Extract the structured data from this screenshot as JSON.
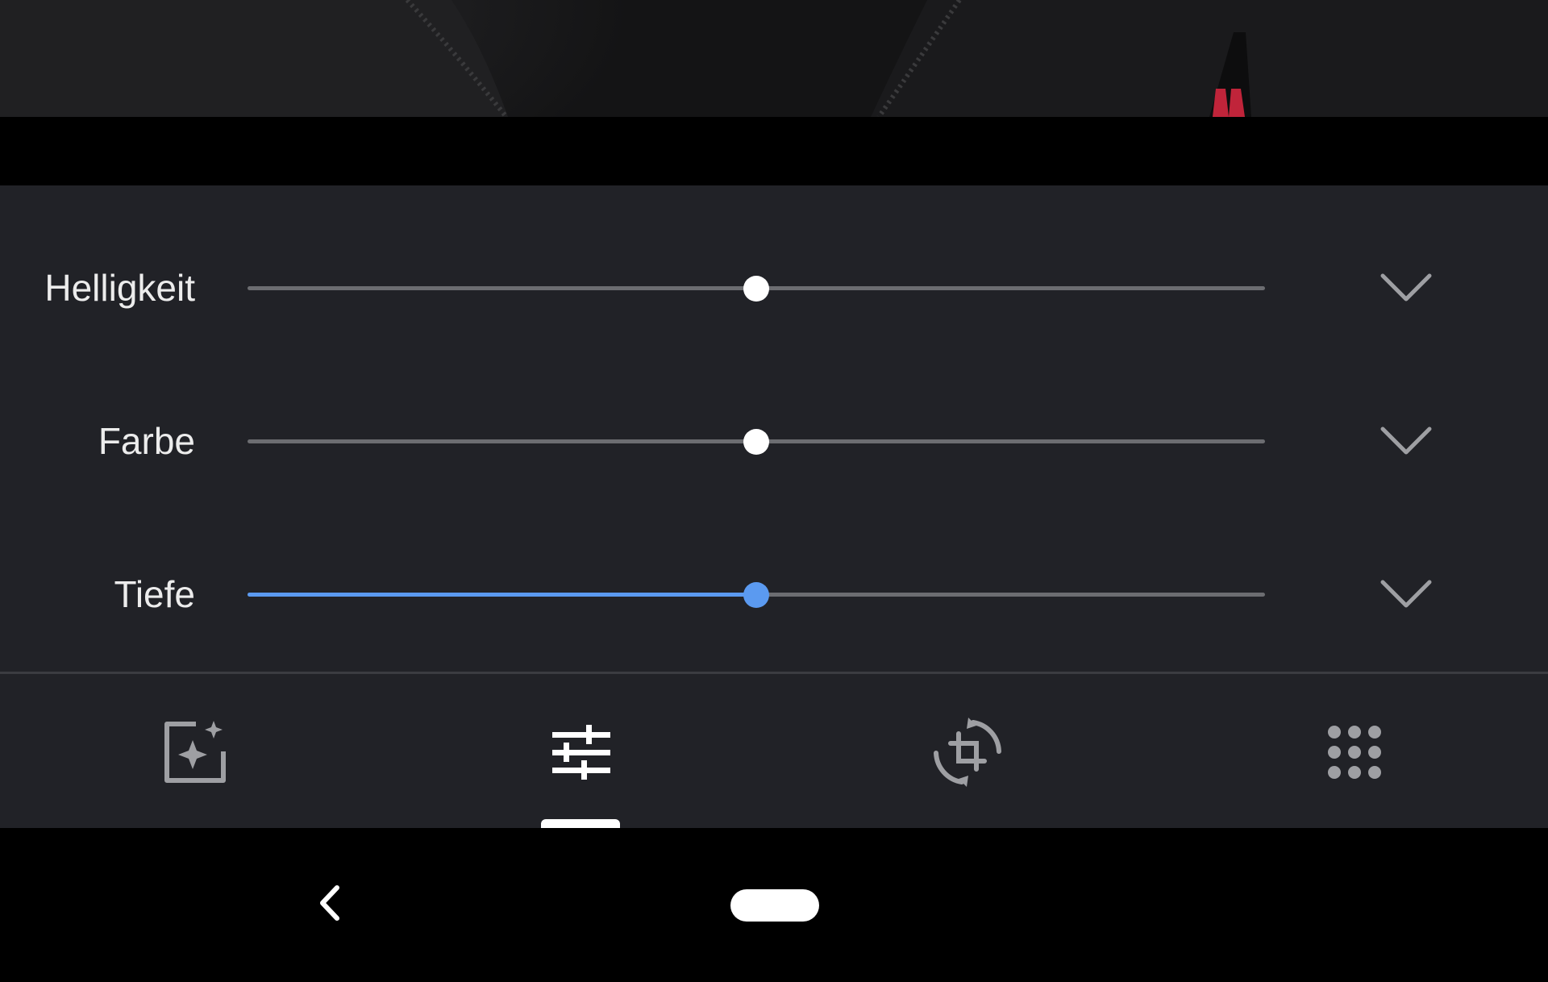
{
  "colors": {
    "panel_bg": "#212227",
    "track": "#6c6d71",
    "accent": "#5b9af0",
    "thumb_default": "#ffffff",
    "label": "#ececec",
    "icon": "#9e9fa3",
    "icon_active": "#ffffff"
  },
  "photo": {
    "description_icon": "photo-preview"
  },
  "sliders": [
    {
      "label": "Helligkeit",
      "value": 0.5,
      "active": false,
      "expand_icon": "chevron-down-icon"
    },
    {
      "label": "Farbe",
      "value": 0.5,
      "active": false,
      "expand_icon": "chevron-down-icon"
    },
    {
      "label": "Tiefe",
      "value": 0.5,
      "active": true,
      "expand_icon": "chevron-down-icon"
    }
  ],
  "toolbar": {
    "tabs": [
      {
        "icon": "auto-enhance-icon",
        "selected": false
      },
      {
        "icon": "adjust-sliders-icon",
        "selected": true
      },
      {
        "icon": "crop-rotate-icon",
        "selected": false
      },
      {
        "icon": "filters-grid-icon",
        "selected": false
      }
    ]
  },
  "navigation": {
    "back_icon": "back-chevron-icon",
    "home_icon": "home-pill-icon"
  }
}
